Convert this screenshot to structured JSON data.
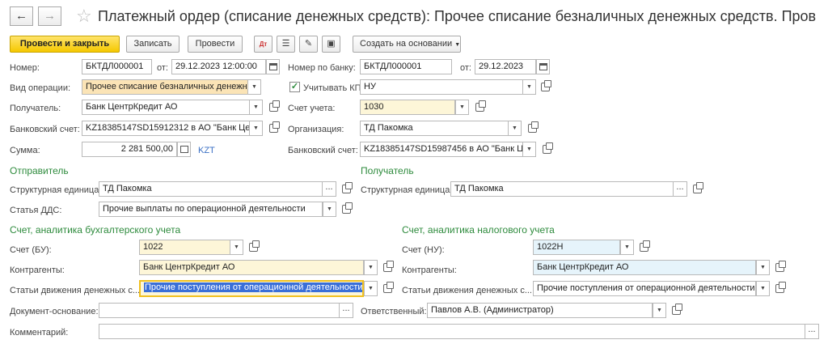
{
  "header": {
    "title": "Платежный ордер (списание денежных средств): Прочее списание безналичных денежных средств. Пров",
    "back_icon": "←",
    "forward_icon": "→",
    "star_icon": "☆"
  },
  "toolbar": {
    "post_close": "Провести и закрыть",
    "save": "Записать",
    "post": "Провести",
    "create_based": "Создать на основании"
  },
  "form": {
    "number_label": "Номер:",
    "number_value": "БКТДЛ000001",
    "from_label": "от:",
    "date_value": "29.12.2023 12:00:00",
    "bank_number_label": "Номер по банку:",
    "bank_number_value": "БКТДЛ000001",
    "bank_from_label": "от:",
    "bank_date_value": "29.12.2023",
    "operation_label": "Вид операции:",
    "operation_value": "Прочее списание безналичных денежны",
    "kpn_label": "Учитывать КПН",
    "kpn_value": "НУ",
    "recipient_label": "Получатель:",
    "recipient_value": "Банк ЦентрКредит АО",
    "account_label": "Счет учета:",
    "account_value": "1030",
    "bank_account_label": "Банковский счет:",
    "bank_account_value": "KZ18385147SD15912312 в АО \"Банк Цент",
    "org_label": "Организация:",
    "org_value": "ТД Пакомка",
    "amount_label": "Сумма:",
    "amount_value": "2 281 500,00",
    "currency": "KZT",
    "bank_account2_label": "Банковский счет:",
    "bank_account2_value": "KZ18385147SD15987456 в АО \"Банк Це"
  },
  "sender": {
    "heading": "Отправитель",
    "unit_label": "Структурная единица:",
    "unit_value": "ТД Пакомка",
    "dds_label": "Статья ДДС:",
    "dds_value": "Прочие выплаты по операционной деятельности"
  },
  "receiver": {
    "heading": "Получатель",
    "unit_label": "Структурная единица:",
    "unit_value": "ТД Пакомка"
  },
  "accounting": {
    "heading": "Счет, аналитика бухгалтерского учета",
    "account_label": "Счет (БУ):",
    "account_value": "1022",
    "counterparty_label": "Контрагенты:",
    "counterparty_value": "Банк ЦентрКредит АО",
    "cashflow_label": "Статьи движения денежных с...",
    "cashflow_value": "Прочие поступления от операционной деятельности"
  },
  "tax": {
    "heading": "Счет, аналитика налогового учета",
    "account_label": "Счет (НУ):",
    "account_value": "1022Н",
    "counterparty_label": "Контрагенты:",
    "counterparty_value": "Банк ЦентрКредит АО",
    "cashflow_label": "Статьи движения денежных с...",
    "cashflow_value": "Прочие поступления от операционной деятельности"
  },
  "footer": {
    "basis_label": "Документ-основание:",
    "basis_value": "",
    "responsible_label": "Ответственный:",
    "responsible_value": "Павлов А.В. (Администратор)",
    "comment_label": "Комментарий:",
    "comment_value": ""
  },
  "colors": {
    "accent_green": "#2e8b3d",
    "primary_yellow": "#f5c800",
    "selection_blue": "#3a6fd8"
  }
}
